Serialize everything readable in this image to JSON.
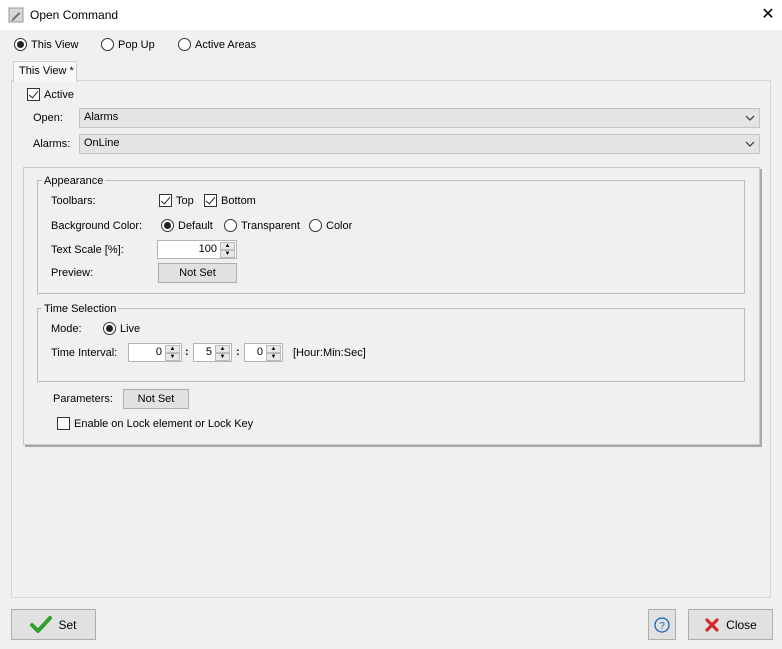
{
  "window": {
    "title": "Open Command",
    "close_icon": "close-icon"
  },
  "mode_options": [
    {
      "label": "This View",
      "selected": true
    },
    {
      "label": "Pop Up",
      "selected": false
    },
    {
      "label": "Active Areas",
      "selected": false
    }
  ],
  "tab": {
    "label": "This View *"
  },
  "active": {
    "label": "Active",
    "checked": true
  },
  "open": {
    "label": "Open:",
    "value": "Alarms"
  },
  "alarms": {
    "label": "Alarms:",
    "value": "OnLine"
  },
  "appearance": {
    "legend": "Appearance",
    "toolbars_label": "Toolbars:",
    "toolbar_top": {
      "label": "Top",
      "checked": true
    },
    "toolbar_bottom": {
      "label": "Bottom",
      "checked": true
    },
    "bg_label": "Background Color:",
    "bg_options": [
      {
        "label": "Default",
        "selected": true
      },
      {
        "label": "Transparent",
        "selected": false
      },
      {
        "label": "Color",
        "selected": false
      }
    ],
    "text_scale_label": "Text Scale [%]:",
    "text_scale_value": "100",
    "preview_label": "Preview:",
    "preview_button": "Not Set"
  },
  "time_selection": {
    "legend": "Time Selection",
    "mode_label": "Mode:",
    "live": {
      "label": "Live",
      "selected": true
    },
    "interval_label": "Time Interval:",
    "hours": "0",
    "minutes": "5",
    "seconds": "0",
    "separator": ":",
    "unit_hint": "[Hour:Min:Sec]"
  },
  "parameters": {
    "label": "Parameters:",
    "button": "Not Set"
  },
  "lock": {
    "label": "Enable on Lock element or Lock Key",
    "checked": false
  },
  "footer": {
    "set_label": "Set",
    "set_icon": "checkmark-icon",
    "help_icon": "help-icon",
    "close_label": "Close",
    "close_icon": "red-x-icon",
    "accent_green": "#2ea12e",
    "accent_red": "#d42a2a",
    "accent_blue": "#1565c0"
  }
}
